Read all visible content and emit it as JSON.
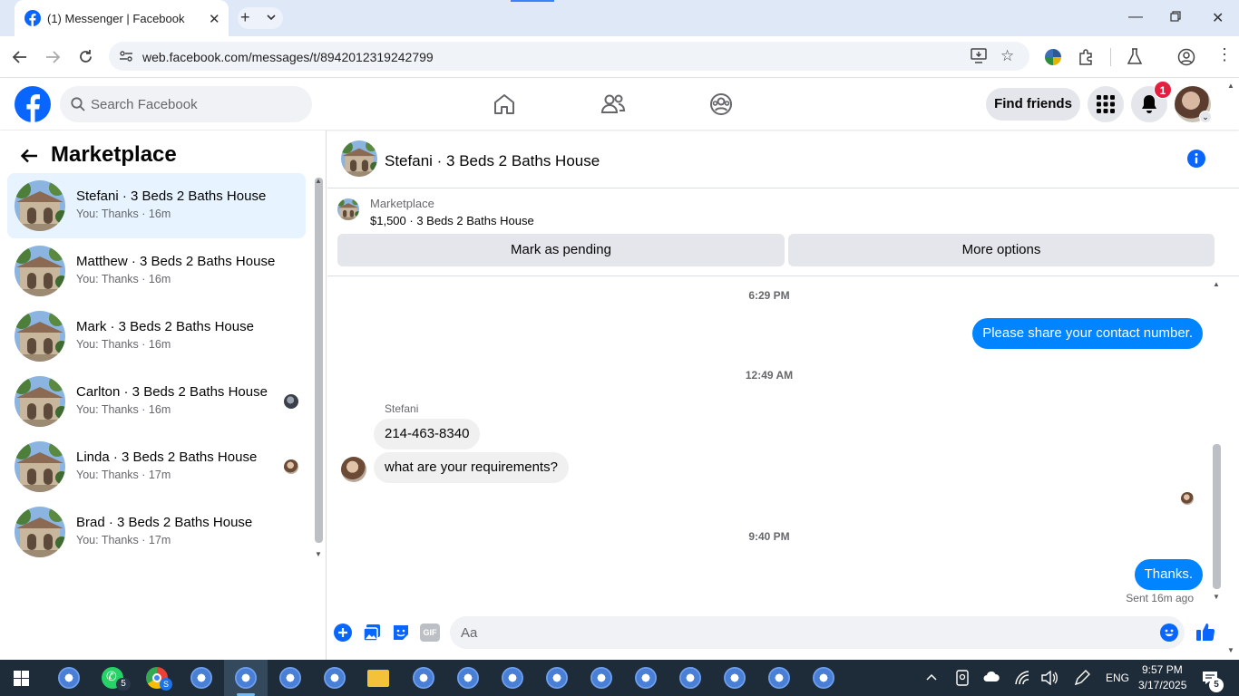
{
  "browser": {
    "tab_title": "(1) Messenger | Facebook",
    "url": "web.facebook.com/messages/t/8942012319242799"
  },
  "header": {
    "search_placeholder": "Search Facebook",
    "find_friends": "Find friends",
    "notification_count": "1"
  },
  "sidebar": {
    "title": "Marketplace",
    "conversations": [
      {
        "name": "Stefani · 3 Beds 2 Baths House",
        "snippet": "You: Thanks · 16m",
        "active": true
      },
      {
        "name": "Matthew · 3 Beds 2 Baths House",
        "snippet": "You: Thanks · 16m"
      },
      {
        "name": "Mark · 3 Beds 2 Baths House",
        "snippet": "You: Thanks · 16m"
      },
      {
        "name": "Carlton · 3 Beds 2 Baths House",
        "snippet": "You: Thanks · 16m"
      },
      {
        "name": "Linda · 3 Beds 2 Baths House",
        "snippet": "You: Thanks · 17m"
      },
      {
        "name": "Brad · 3 Beds 2 Baths House",
        "snippet": "You: Thanks · 17m"
      }
    ]
  },
  "chat": {
    "title": "Stefani · 3 Beds 2 Baths House",
    "listing_category": "Marketplace",
    "listing_price": "$1,500 · 3 Beds 2 Baths House",
    "mark_pending": "Mark as pending",
    "more_options": "More options",
    "time1": "6:29 PM",
    "msg_out1": "Please share your contact number.",
    "time2": "12:49 AM",
    "sender": "Stefani",
    "msg_in1": "214-463-8340",
    "msg_in2": "what are your requirements?",
    "time3": "9:40 PM",
    "msg_out2": "Thanks.",
    "sent_status": "Sent 16m ago",
    "input_placeholder": "Aa"
  },
  "taskbar": {
    "whatsapp_badge": "5",
    "chrome_badge": "S",
    "language": "ENG",
    "time": "9:57 PM",
    "date": "3/17/2025",
    "notification_count": "5"
  },
  "colors": {
    "facebook_blue": "#0866ff",
    "messenger_blue": "#0084ff",
    "badge_red": "#e41e3f",
    "active_row": "#e7f3ff"
  }
}
